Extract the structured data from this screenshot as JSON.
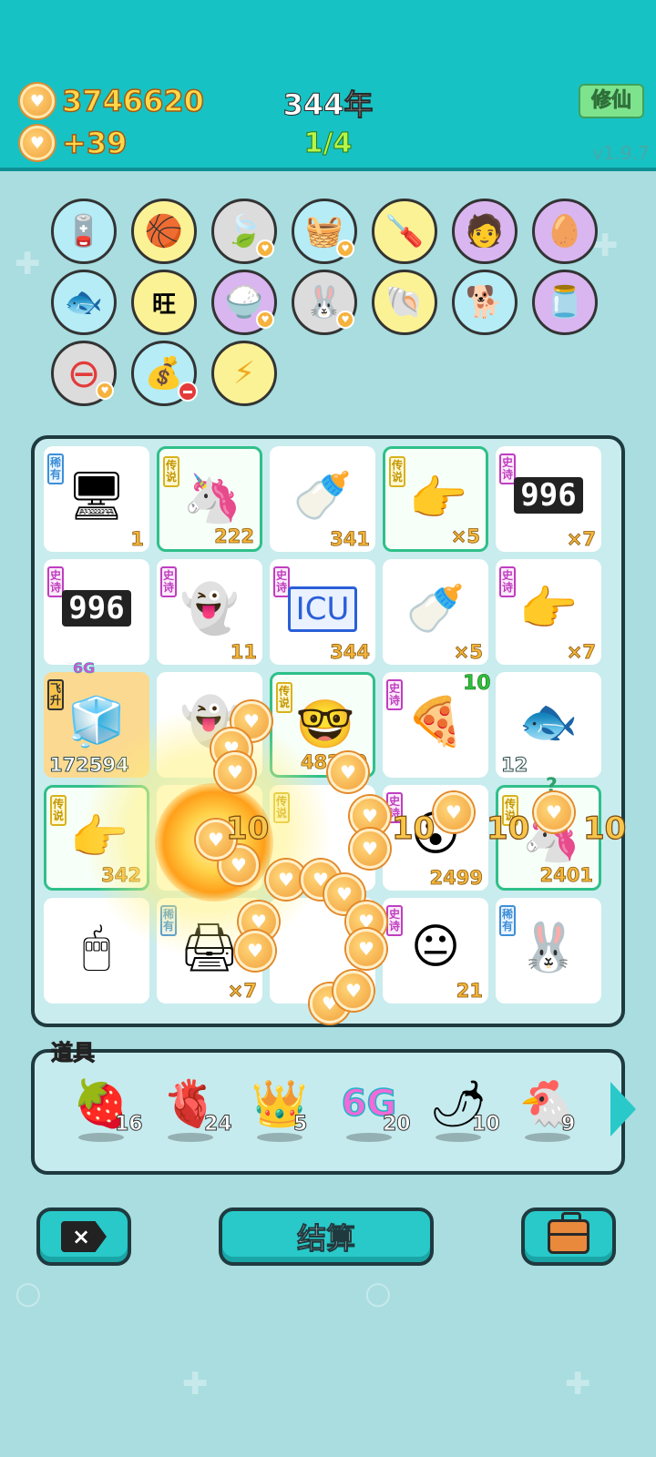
{
  "header": {
    "coins_total": "3746620",
    "coins_rate": "+39",
    "year": "344年",
    "progress": "1/4",
    "xiuxian_button": "修仙",
    "version": "v1.9.7"
  },
  "collection": [
    {
      "name": "pump",
      "icon": "🪫",
      "bg": "#b5ecf6"
    },
    {
      "name": "basketballs",
      "icon": "🏀",
      "bg": "#fbf296"
    },
    {
      "name": "leaf",
      "icon": "🍃",
      "bg": "#dcdcdc"
    },
    {
      "name": "fruit-basket",
      "icon": "🧺",
      "bg": "#b5ecf6"
    },
    {
      "name": "screwdriver",
      "icon": "🪛",
      "bg": "#fbf296"
    },
    {
      "name": "lottery-person",
      "icon": "🧑",
      "bg": "#d9b6f0"
    },
    {
      "name": "egg",
      "icon": "🥚",
      "bg": "#d9b6f0"
    },
    {
      "name": "fish-bowl",
      "icon": "🐟",
      "bg": "#b5ecf6"
    },
    {
      "name": "wang-characters",
      "icon": "旺",
      "bg": "#fbf296"
    },
    {
      "name": "rice-bowl",
      "icon": "🍚",
      "bg": "#d9b6f0"
    },
    {
      "name": "rabbit",
      "icon": "🐰",
      "bg": "#dcdcdc"
    },
    {
      "name": "shell",
      "icon": "🐚",
      "bg": "#fbf296"
    },
    {
      "name": "cool-dog",
      "icon": "🐕",
      "bg": "#b5ecf6"
    },
    {
      "name": "jar",
      "icon": "🫙",
      "bg": "#d9b6f0"
    },
    {
      "name": "minus-sign",
      "icon": "⊖",
      "bg": "#dcdcdc"
    },
    {
      "name": "sack",
      "icon": "💰",
      "bg": "#b5ecf6"
    },
    {
      "name": "lightning",
      "icon": "⚡",
      "bg": "#fbf296"
    }
  ],
  "board": [
    {
      "tag": "稀有",
      "tagType": "rare",
      "icon": "🖥",
      "value": "1"
    },
    {
      "tag": "传说",
      "tagType": "legend",
      "icon": "🦄",
      "value": "222"
    },
    {
      "tag": "",
      "tagType": "",
      "icon": "🍼",
      "value": "341"
    },
    {
      "tag": "传说",
      "tagType": "legend",
      "icon": "👉",
      "value": "×5"
    },
    {
      "tag": "史诗",
      "tagType": "epic",
      "icon": "996",
      "value": "×7"
    },
    {
      "tag": "史诗",
      "tagType": "epic",
      "icon": "996",
      "value": ""
    },
    {
      "tag": "史诗",
      "tagType": "epic",
      "icon": "👻",
      "value": "11"
    },
    {
      "tag": "史诗",
      "tagType": "epic",
      "icon": "ICU",
      "value": "344"
    },
    {
      "tag": "",
      "tagType": "",
      "icon": "🍼",
      "value": "×5"
    },
    {
      "tag": "史诗",
      "tagType": "epic",
      "icon": "👉",
      "value": "×7"
    },
    {
      "tag": "飞升",
      "tagType": "fly",
      "icon": "🧊",
      "value": "172594",
      "top": "6G"
    },
    {
      "tag": "",
      "tagType": "",
      "icon": "👻",
      "value": ""
    },
    {
      "tag": "传说",
      "tagType": "legend",
      "icon": "🤓",
      "value": "48290"
    },
    {
      "tag": "史诗",
      "tagType": "epic",
      "icon": "🍕",
      "value": "",
      "top": "10"
    },
    {
      "tag": "",
      "tagType": "",
      "icon": "🐟",
      "value": "12"
    },
    {
      "tag": "传说",
      "tagType": "legend",
      "icon": "👉",
      "value": "342"
    },
    {
      "tag": "",
      "tagType": "",
      "icon": "",
      "value": ""
    },
    {
      "tag": "传说",
      "tagType": "legend",
      "icon": "",
      "value": ""
    },
    {
      "tag": "史诗",
      "tagType": "epic",
      "icon": "😮",
      "value": "2499"
    },
    {
      "tag": "传说",
      "tagType": "legend",
      "icon": "🦄",
      "value": "2401",
      "top": "?"
    },
    {
      "tag": "",
      "tagType": "",
      "icon": "🖱",
      "value": ""
    },
    {
      "tag": "稀有",
      "tagType": "rare",
      "icon": "🖨",
      "value": "×7"
    },
    {
      "tag": "",
      "tagType": "",
      "icon": "",
      "value": ""
    },
    {
      "tag": "史诗",
      "tagType": "epic",
      "icon": "😐",
      "value": "21"
    },
    {
      "tag": "稀有",
      "tagType": "rare",
      "icon": "🐰",
      "value": ""
    }
  ],
  "effects": {
    "labels": [
      "10",
      "10",
      "10",
      "10"
    ]
  },
  "items": {
    "title": "道具",
    "list": [
      {
        "icon": "🍓",
        "count": "16"
      },
      {
        "icon": "🫀",
        "count": "24"
      },
      {
        "icon": "👑",
        "count": "5"
      },
      {
        "icon": "6G",
        "count": "20"
      },
      {
        "icon": "🌶",
        "count": "10"
      },
      {
        "icon": "🐔",
        "count": "9"
      }
    ]
  },
  "buttons": {
    "settle": "结算",
    "exit_icon": "×"
  }
}
